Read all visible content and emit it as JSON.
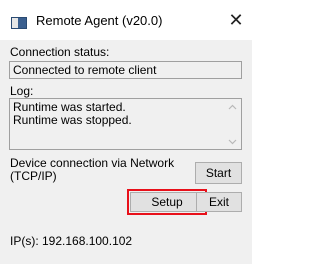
{
  "window": {
    "title": "Remote Agent (v20.0)",
    "close_glyph": "✕"
  },
  "connection": {
    "label": "Connection status:",
    "value": "Connected to remote client"
  },
  "log": {
    "label": "Log:",
    "lines": [
      "Runtime was started.",
      "Runtime was stopped."
    ]
  },
  "device": {
    "label_line1": "Device connection via Network",
    "label_line2": "(TCP/IP)",
    "start_label": "Start",
    "setup_label": "Setup",
    "exit_label": "Exit"
  },
  "ip": {
    "text": "IP(s): 192.168.100.102"
  },
  "colors": {
    "highlight": "#e8101a",
    "app_icon": "#3a5f8f"
  },
  "icons": [
    "app-icon",
    "close-icon",
    "scroll-up-arrow-icon",
    "scroll-down-arrow-icon"
  ]
}
